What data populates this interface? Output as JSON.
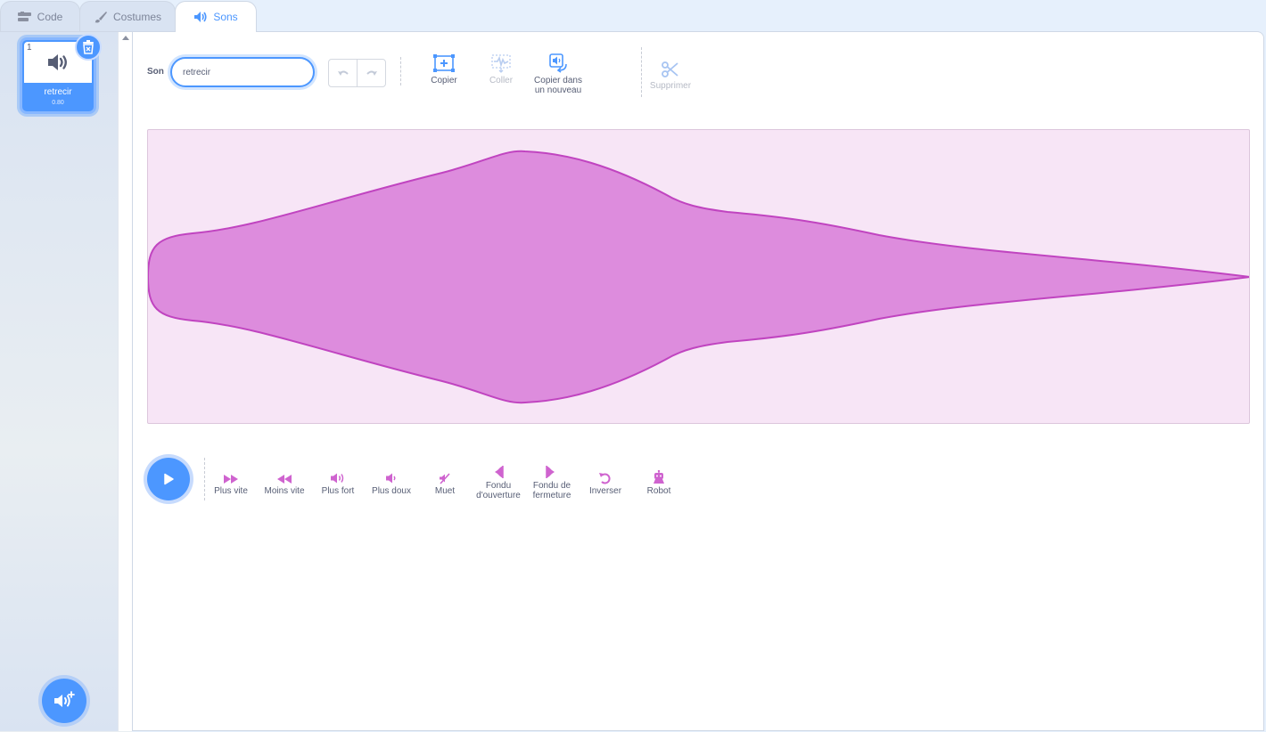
{
  "tabs": [
    {
      "label": "Code",
      "icon": "code-icon"
    },
    {
      "label": "Costumes",
      "icon": "brush-icon"
    },
    {
      "label": "Sons",
      "icon": "speaker-icon"
    }
  ],
  "active_tab": "Sons",
  "sound_list": {
    "items": [
      {
        "number": "1",
        "name": "retrecir",
        "duration": "0.80",
        "selected": true
      }
    ]
  },
  "editor": {
    "sound_label": "Son",
    "sound_name": "retrecir",
    "tools": {
      "copy": "Copier",
      "paste": "Coller",
      "copy_new_line1": "Copier dans",
      "copy_new_line2": "un nouveau",
      "delete": "Supprimer"
    },
    "effects": {
      "faster": "Plus vite",
      "slower": "Moins vite",
      "louder": "Plus fort",
      "softer": "Plus doux",
      "mute": "Muet",
      "fade_in_line1": "Fondu",
      "fade_in_line2": "d'ouverture",
      "fade_out_line1": "Fondu de",
      "fade_out_line2": "fermeture",
      "reverse": "Inverser",
      "robot": "Robot"
    }
  },
  "colors": {
    "accent": "#4c97ff",
    "waveform_fill": "#dd8cdd",
    "waveform_stroke": "#c044c0",
    "waveform_bg": "#f7e5f6",
    "effect_icon": "#cf63cf"
  }
}
